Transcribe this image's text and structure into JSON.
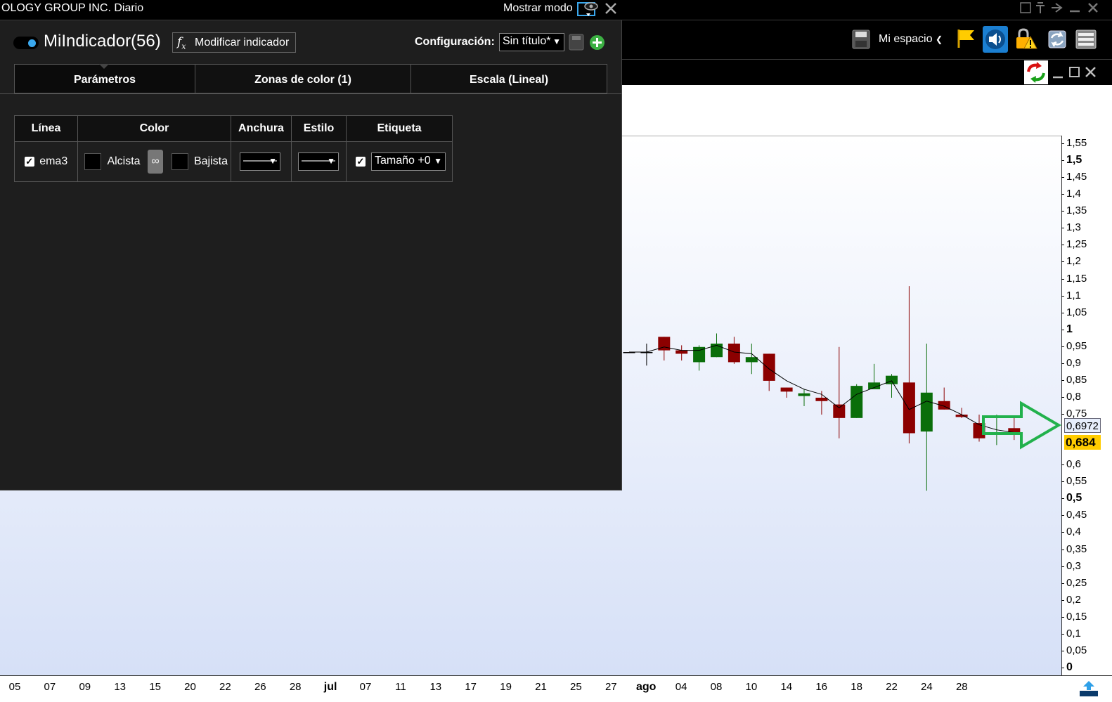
{
  "window": {
    "title": "OLOGY GROUP INC. Diario",
    "mostrar_modo": "Mostrar modo"
  },
  "toolbar": {
    "workspace_label": "Mi espacio",
    "icons": [
      "save-icon",
      "flag-icon",
      "speaker-icon",
      "lock-alert-icon",
      "refresh-sync-icon",
      "keyboard-icon"
    ]
  },
  "panel": {
    "indicator_name": "MiIndicador(56)",
    "modify_fx": "f",
    "modify_fx_sub": "x",
    "modify_button": "Modificar indicador",
    "config_label": "Configuración:",
    "config_value": "Sin título*",
    "tabs": [
      "Parámetros",
      "Zonas de color (1)",
      "Escala (Lineal)"
    ],
    "table": {
      "headers": [
        "Línea",
        "Color",
        "Anchura",
        "Estilo",
        "Etiqueta"
      ],
      "row": {
        "line_name": "ema3",
        "up_label": "Alcista",
        "down_label": "Bajista",
        "width_value": "———",
        "style_value": "———",
        "label_value": "Tamaño +0"
      }
    }
  },
  "chart_data": {
    "type": "candlestick",
    "ylim": [
      0,
      1.55
    ],
    "y_ticks": [
      "1,55",
      "1,5",
      "1,45",
      "1,4",
      "1,35",
      "1,3",
      "1,25",
      "1,2",
      "1,15",
      "1,1",
      "1,05",
      "1",
      "0,95",
      "0,9",
      "0,85",
      "0,8",
      "0,75",
      "0,6",
      "0,55",
      "0,5",
      "0,45",
      "0,4",
      "0,35",
      "0,3",
      "0,25",
      "0,2",
      "0,15",
      "0,1",
      "0,05",
      "0"
    ],
    "y_bold_ticks": [
      "1,5",
      "1",
      "0,5",
      "0"
    ],
    "x_ticks": [
      "05",
      "07",
      "09",
      "13",
      "15",
      "20",
      "22",
      "26",
      "28",
      "jul",
      "07",
      "11",
      "13",
      "17",
      "19",
      "21",
      "25",
      "27",
      "ago",
      "04",
      "08",
      "10",
      "14",
      "16",
      "18",
      "22",
      "24",
      "28"
    ],
    "x_bold_ticks": [
      "jul",
      "ago"
    ],
    "price_labels": {
      "indicator": "0,6972",
      "last": "0,684"
    },
    "colors": {
      "up": "#0a6e0a",
      "down": "#8c0000",
      "indicator_line": "#000000",
      "arrow": "#22b14c",
      "last_price_bg": "#ffcc00"
    },
    "candles": [
      {
        "o": 0.935,
        "h": 0.935,
        "l": 0.935,
        "c": 0.935
      },
      {
        "o": 0.935,
        "h": 0.96,
        "l": 0.895,
        "c": 0.935
      },
      {
        "o": 0.98,
        "h": 0.98,
        "l": 0.91,
        "c": 0.94
      },
      {
        "o": 0.94,
        "h": 0.955,
        "l": 0.91,
        "c": 0.93
      },
      {
        "o": 0.905,
        "h": 0.955,
        "l": 0.88,
        "c": 0.95
      },
      {
        "o": 0.92,
        "h": 0.99,
        "l": 0.92,
        "c": 0.96
      },
      {
        "o": 0.96,
        "h": 0.98,
        "l": 0.9,
        "c": 0.905
      },
      {
        "o": 0.905,
        "h": 0.96,
        "l": 0.87,
        "c": 0.92
      },
      {
        "o": 0.93,
        "h": 0.93,
        "l": 0.82,
        "c": 0.85
      },
      {
        "o": 0.83,
        "h": 0.83,
        "l": 0.8,
        "c": 0.818
      },
      {
        "o": 0.805,
        "h": 0.825,
        "l": 0.775,
        "c": 0.813
      },
      {
        "o": 0.8,
        "h": 0.82,
        "l": 0.75,
        "c": 0.79
      },
      {
        "o": 0.78,
        "h": 0.95,
        "l": 0.68,
        "c": 0.74
      },
      {
        "o": 0.74,
        "h": 0.84,
        "l": 0.74,
        "c": 0.835
      },
      {
        "o": 0.825,
        "h": 0.9,
        "l": 0.825,
        "c": 0.845
      },
      {
        "o": 0.84,
        "h": 0.87,
        "l": 0.8,
        "c": 0.865
      },
      {
        "o": 0.845,
        "h": 1.13,
        "l": 0.665,
        "c": 0.695
      },
      {
        "o": 0.7,
        "h": 0.96,
        "l": 0.525,
        "c": 0.815
      },
      {
        "o": 0.79,
        "h": 0.83,
        "l": 0.765,
        "c": 0.765
      },
      {
        "o": 0.75,
        "h": 0.77,
        "l": 0.74,
        "c": 0.743
      },
      {
        "o": 0.725,
        "h": 0.75,
        "l": 0.67,
        "c": 0.68
      },
      {
        "o": 0.69,
        "h": 0.75,
        "l": 0.66,
        "c": 0.698
      },
      {
        "o": 0.71,
        "h": 0.74,
        "l": 0.675,
        "c": 0.69
      }
    ],
    "indicator": [
      0.935,
      0.935,
      0.95,
      0.94,
      0.94,
      0.955,
      0.935,
      0.93,
      0.885,
      0.85,
      0.825,
      0.81,
      0.77,
      0.81,
      0.83,
      0.85,
      0.765,
      0.79,
      0.775,
      0.75,
      0.72,
      0.705,
      0.697
    ]
  }
}
